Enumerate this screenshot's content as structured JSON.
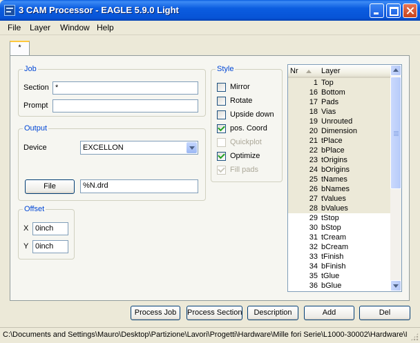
{
  "window": {
    "title": "3 CAM Processor - EAGLE 5.9.0 Light"
  },
  "menu": [
    {
      "label": "File"
    },
    {
      "label": "Layer"
    },
    {
      "label": "Window"
    },
    {
      "label": "Help"
    }
  ],
  "tab": {
    "label": "*"
  },
  "job": {
    "group_title": "Job",
    "section_label": "Section",
    "section_value": "*",
    "prompt_label": "Prompt",
    "prompt_value": ""
  },
  "output": {
    "group_title": "Output",
    "device_label": "Device",
    "device_value": "EXCELLON",
    "file_button": "File",
    "file_value": "%N.drd"
  },
  "offset": {
    "group_title": "Offset",
    "x_label": "X",
    "x_value": "0inch",
    "y_label": "Y",
    "y_value": "0inch"
  },
  "style": {
    "group_title": "Style",
    "options": [
      {
        "label": "Mirror",
        "checked": false,
        "enabled": true
      },
      {
        "label": "Rotate",
        "checked": false,
        "enabled": true
      },
      {
        "label": "Upside down",
        "checked": false,
        "enabled": true
      },
      {
        "label": "pos. Coord",
        "checked": true,
        "enabled": true
      },
      {
        "label": "Quickplot",
        "checked": false,
        "enabled": false
      },
      {
        "label": "Optimize",
        "checked": true,
        "enabled": true
      },
      {
        "label": "Fill pads",
        "checked": true,
        "enabled": false
      }
    ]
  },
  "layers": {
    "col_nr": "Nr",
    "col_layer": "Layer",
    "rows": [
      {
        "nr": "1",
        "name": "Top",
        "selected": true
      },
      {
        "nr": "16",
        "name": "Bottom",
        "selected": true
      },
      {
        "nr": "17",
        "name": "Pads",
        "selected": true
      },
      {
        "nr": "18",
        "name": "Vias",
        "selected": true
      },
      {
        "nr": "19",
        "name": "Unrouted",
        "selected": true
      },
      {
        "nr": "20",
        "name": "Dimension",
        "selected": true
      },
      {
        "nr": "21",
        "name": "tPlace",
        "selected": true
      },
      {
        "nr": "22",
        "name": "bPlace",
        "selected": true
      },
      {
        "nr": "23",
        "name": "tOrigins",
        "selected": true
      },
      {
        "nr": "24",
        "name": "bOrigins",
        "selected": true
      },
      {
        "nr": "25",
        "name": "tNames",
        "selected": true
      },
      {
        "nr": "26",
        "name": "bNames",
        "selected": true
      },
      {
        "nr": "27",
        "name": "tValues",
        "selected": true
      },
      {
        "nr": "28",
        "name": "bValues",
        "selected": true
      },
      {
        "nr": "29",
        "name": "tStop",
        "selected": false
      },
      {
        "nr": "30",
        "name": "bStop",
        "selected": false
      },
      {
        "nr": "31",
        "name": "tCream",
        "selected": false
      },
      {
        "nr": "32",
        "name": "bCream",
        "selected": false
      },
      {
        "nr": "33",
        "name": "tFinish",
        "selected": false
      },
      {
        "nr": "34",
        "name": "bFinish",
        "selected": false
      },
      {
        "nr": "35",
        "name": "tGlue",
        "selected": false
      },
      {
        "nr": "36",
        "name": "bGlue",
        "selected": false
      }
    ]
  },
  "buttons": {
    "process_job": "Process Job",
    "process_section": "Process Section",
    "description": "Description",
    "add": "Add",
    "del": "Del"
  },
  "status": {
    "path": "C:\\Documents and Settings\\Mauro\\Desktop\\Partizione\\Lavori\\Progetti\\Hardware\\Mille fori Serie\\L1000-30002\\Hardware\\I"
  }
}
